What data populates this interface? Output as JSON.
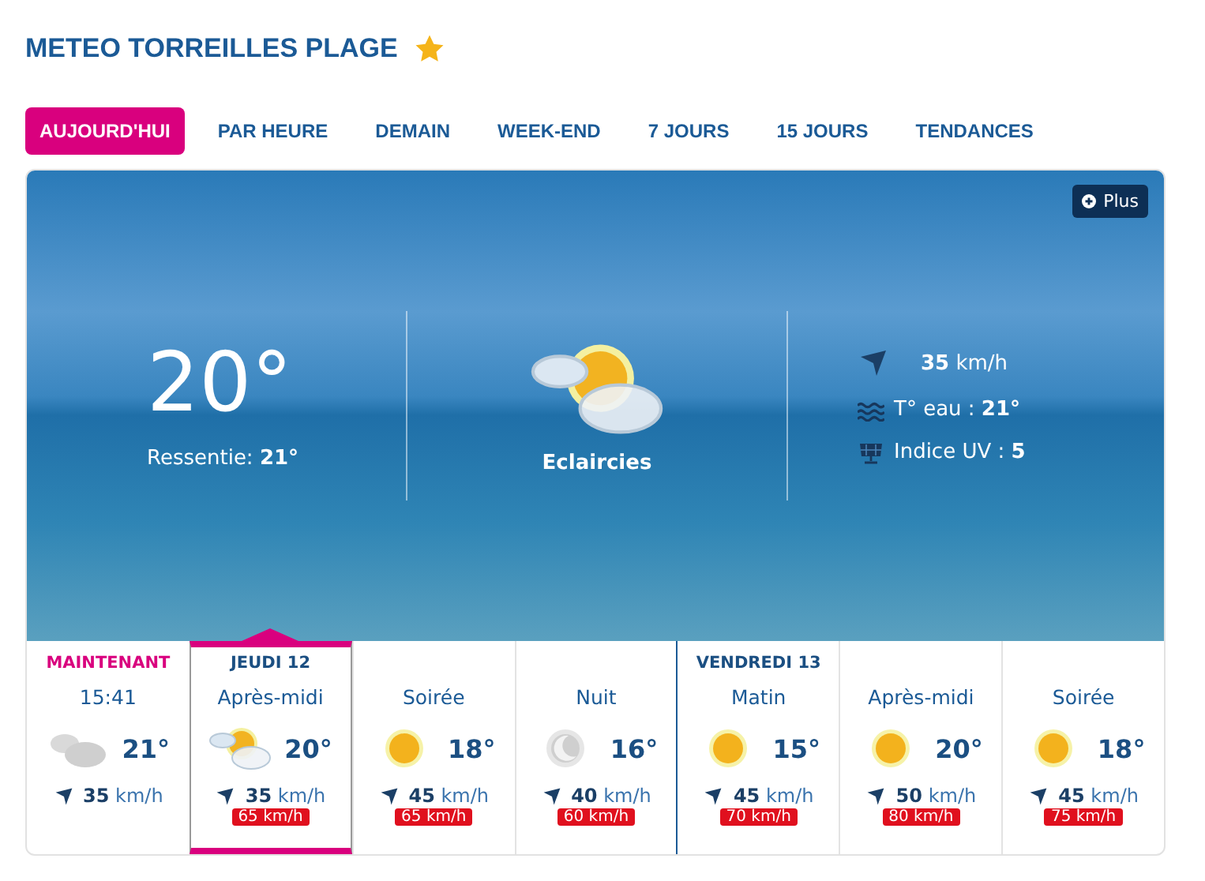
{
  "title": "METEO TORREILLES PLAGE",
  "favorite": true,
  "tabs": [
    {
      "label": "AUJOURD'HUI",
      "selected": true
    },
    {
      "label": "PAR HEURE",
      "selected": false
    },
    {
      "label": "DEMAIN",
      "selected": false
    },
    {
      "label": "WEEK-END",
      "selected": false
    },
    {
      "label": "7 JOURS",
      "selected": false
    },
    {
      "label": "15 JOURS",
      "selected": false
    },
    {
      "label": "TENDANCES",
      "selected": false
    }
  ],
  "current": {
    "more_button": "Plus",
    "temperature": "20°",
    "feels_like_label": "Ressentie:",
    "feels_like": "21°",
    "condition": "Eclaircies",
    "wind_speed": "35",
    "wind_unit": "km/h",
    "water_label": "T° eau :",
    "water_temp": "21°",
    "uv_label": "Indice UV :",
    "uv": "5"
  },
  "slots": [
    {
      "header": "MAINTENANT",
      "current": true,
      "day_start": false,
      "period": "15:41",
      "kind": "cloudy",
      "temperature": "21°",
      "wind_speed": "35",
      "wind_unit": "km/h",
      "selected": false
    },
    {
      "header": "JEUDI 12",
      "current": false,
      "day_start": true,
      "period": "Après-midi",
      "kind": "partly-sunny",
      "temperature": "20°",
      "wind_speed": "35",
      "wind_unit": "km/h",
      "gust": "65 km/h",
      "selected": true
    },
    {
      "day_start": false,
      "period": "Soirée",
      "kind": "sunny",
      "temperature": "18°",
      "wind_speed": "45",
      "wind_unit": "km/h",
      "gust": "65 km/h",
      "selected": false
    },
    {
      "day_start": false,
      "period": "Nuit",
      "kind": "moon",
      "temperature": "16°",
      "wind_speed": "40",
      "wind_unit": "km/h",
      "gust": "60 km/h",
      "selected": false
    },
    {
      "header": "VENDREDI 13",
      "current": false,
      "day_start": true,
      "period": "Matin",
      "kind": "sunny",
      "temperature": "15°",
      "wind_speed": "45",
      "wind_unit": "km/h",
      "gust": "70 km/h",
      "selected": false
    },
    {
      "day_start": false,
      "period": "Après-midi",
      "kind": "sunny",
      "temperature": "20°",
      "wind_speed": "50",
      "wind_unit": "km/h",
      "gust": "80 km/h",
      "selected": false
    },
    {
      "day_start": false,
      "period": "Soirée",
      "kind": "sunny",
      "temperature": "18°",
      "wind_speed": "45",
      "wind_unit": "km/h",
      "gust": "75 km/h",
      "selected": false
    }
  ]
}
